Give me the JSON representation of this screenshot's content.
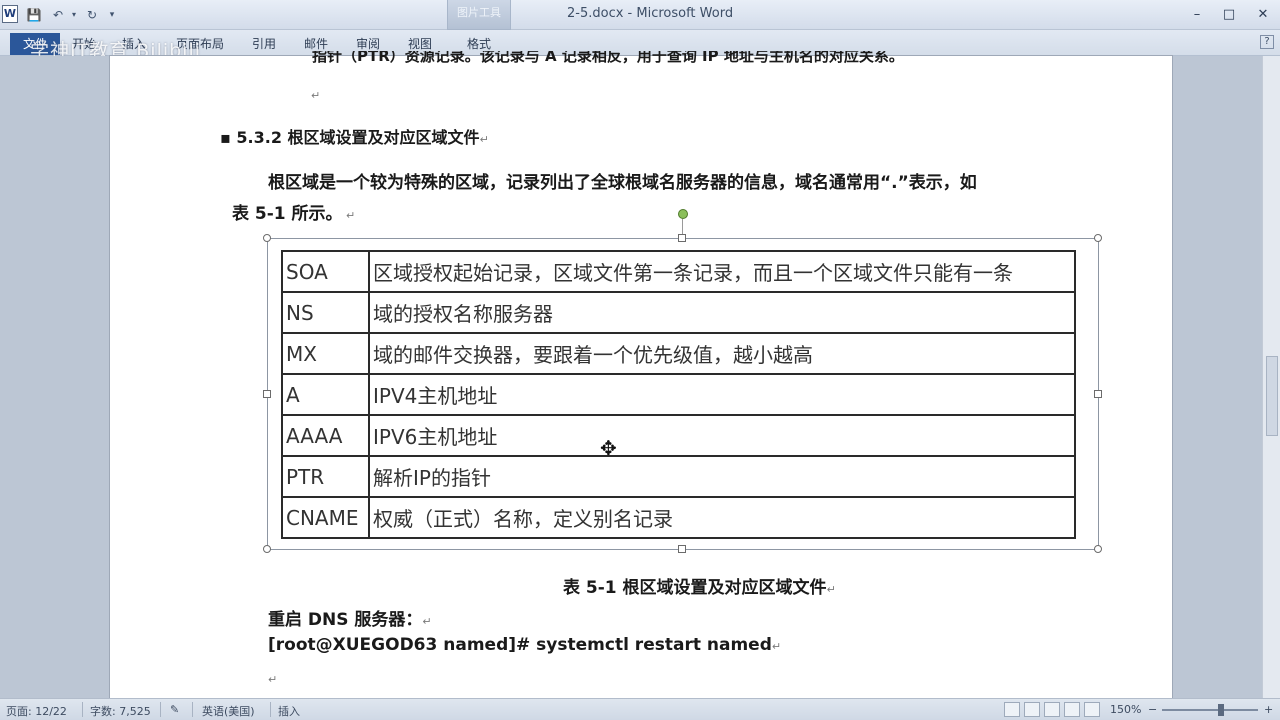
{
  "window": {
    "app_icon": "W",
    "title": "2-5.docx - Microsoft Word",
    "context_tab": "图片工具",
    "controls": {
      "minimize": "–",
      "maximize": "□",
      "close": "✕"
    }
  },
  "watermark": "学神IT教育 Bilibili",
  "ribbon": {
    "file_tab": "文件",
    "tabs": [
      "开始",
      "插入",
      "页面布局",
      "引用",
      "邮件",
      "审阅",
      "视图",
      "格式"
    ]
  },
  "document": {
    "top_line": "指针（PTR）资源记录。该记录与 A 记录相反，用于查询 IP 地址与主机名的对应关系。",
    "heading": "5.3.2 根区域设置及对应区域文件",
    "body_line1": "根区域是一个较为特殊的区域，记录列出了全球根域名服务器的信息，域名通常用“.”表示，如",
    "body_line2": "表  5-1  所示。",
    "table_rows": [
      {
        "type": "SOA",
        "desc": "区域授权起始记录，区域文件第一条记录，而且一个区域文件只能有一条"
      },
      {
        "type": "NS",
        "desc": "域的授权名称服务器"
      },
      {
        "type": "MX",
        "desc": "域的邮件交换器，要跟着一个优先级值，越小越高"
      },
      {
        "type": "A",
        "desc": "IPV4主机地址"
      },
      {
        "type": "AAAA",
        "desc": "IPV6主机地址"
      },
      {
        "type": "PTR",
        "desc": "解析IP的指针"
      },
      {
        "type": "CNAME",
        "desc": "权威（正式）名称，定义别名记录"
      }
    ],
    "caption": "表  5-1  根区域设置及对应区域文件",
    "restart_label": "重启 DNS 服务器：",
    "command": "[root@XUEGOD63 named]# systemctl restart named"
  },
  "statusbar": {
    "page": "页面: 12/22",
    "words": "字数: 7,525",
    "language": "英语(美国)",
    "mode": "插入",
    "zoom": "150%"
  }
}
